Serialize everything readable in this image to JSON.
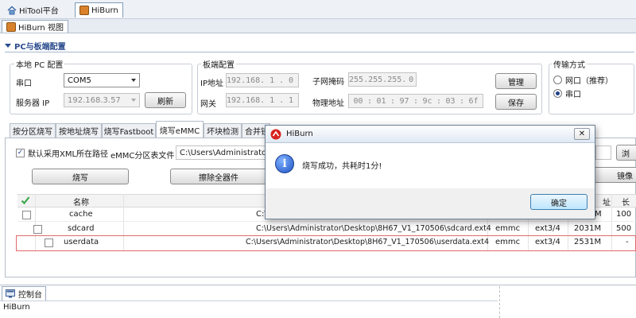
{
  "top_tabs": [
    {
      "label": "HiTool平台"
    },
    {
      "label": "HiBurn"
    }
  ],
  "view": {
    "title": "HiBurn 视图"
  },
  "section": {
    "title": "PC与板端配置"
  },
  "local_pc": {
    "title": "本地 PC 配置",
    "serial_label": "串口",
    "serial_value": "COM5",
    "server_ip_label": "服务器 IP",
    "server_ip_value": "192.168.3.57",
    "refresh_button": "刷新"
  },
  "board": {
    "title": "板端配置",
    "ip_label": "IP地址",
    "ip": [
      "192",
      "168",
      "1",
      "0"
    ],
    "gateway_label": "网关",
    "gateway": [
      "192",
      "168",
      "1",
      "1"
    ],
    "mask_label": "子网掩码",
    "mask": [
      "255",
      "255",
      "255",
      "0"
    ],
    "mac_label": "物理地址",
    "mac": [
      "00",
      "01",
      "97",
      "9c",
      "03",
      "6f"
    ],
    "manage_button": "管理",
    "save_button": "保存"
  },
  "transfer": {
    "title": "传输方式",
    "options": [
      {
        "label": "网口（推荐）",
        "selected": false
      },
      {
        "label": "串口",
        "selected": true
      }
    ]
  },
  "inner_tabs": [
    {
      "label": "按分区烧写"
    },
    {
      "label": "按地址烧写"
    },
    {
      "label": "烧写Fastboot"
    },
    {
      "label": "烧写eMMC"
    },
    {
      "label": "坏块检测"
    },
    {
      "label": "合并镜"
    }
  ],
  "emmc": {
    "default_xml_label": "默认采用XML所在路径",
    "partition_file_label": "eMMC分区表文件",
    "partition_file_value": "C:\\Users\\Administrator\\",
    "browse_button_partial": "浏",
    "burn_button": "烧写",
    "erase_button": "擦除全器件",
    "image_button_partial": "镜像"
  },
  "table": {
    "headers": [
      "名称",
      "址",
      "长"
    ],
    "rows": [
      {
        "name": "cache",
        "path": "C:\\",
        "media": "",
        "fs": "",
        "size": "M",
        "extra": "100"
      },
      {
        "name": "sdcard",
        "path": "C:\\Users\\Administrator\\Desktop\\8H67_V1_170506\\sdcard.ext4",
        "media": "emmc",
        "fs": "ext3/4",
        "size": "2031M",
        "extra": "500"
      },
      {
        "name": "userdata",
        "path": "C:\\Users\\Administrator\\Desktop\\8H67_V1_170506\\userdata.ext4",
        "media": "emmc",
        "fs": "ext3/4",
        "size": "2531M",
        "extra": "-"
      }
    ]
  },
  "dialog": {
    "title": "HiBurn",
    "message": "烧写成功，共耗时1分!",
    "ok_button": "确定",
    "close_glyph": "✕",
    "info_glyph": "i"
  },
  "console": {
    "tab_label": "控制台",
    "text": "HiBurn"
  },
  "colors": {
    "accent": "#2a4b8d",
    "highlight_row_border": "#e06a6a",
    "check_green": "#3aa84a"
  }
}
